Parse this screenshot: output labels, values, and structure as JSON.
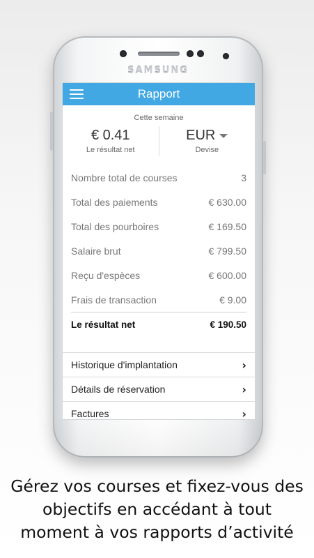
{
  "device": {
    "brand": "SAMSUNG"
  },
  "appbar": {
    "title": "Rapport",
    "menu_icon": "hamburger-menu-icon"
  },
  "summary": {
    "period": "Cette semaine",
    "net_value": "€ 0.41",
    "net_label": "Le résultat net",
    "currency_value": "EUR",
    "currency_label": "Devise"
  },
  "report_rows": [
    {
      "label": "Nombre total de courses",
      "value": "3"
    },
    {
      "label": "Total des paiements",
      "value": "€ 630.00"
    },
    {
      "label": "Total des pourboires",
      "value": "€ 169.50"
    },
    {
      "label": "Salaire brut",
      "value": "€ 799.50"
    },
    {
      "label": "Reçu d'espèces",
      "value": "€ 600.00"
    },
    {
      "label": "Frais de transaction",
      "value": "€ 9.00"
    }
  ],
  "total_row": {
    "label": "Le résultat net",
    "value": "€ 190.50"
  },
  "nav": [
    {
      "label": "Historique d'implantation"
    },
    {
      "label": "Détails de réservation"
    },
    {
      "label": "Factures"
    }
  ],
  "caption": {
    "line1": "Gérez vos courses et fixez-vous des",
    "line2": "objectifs en accédant à tout",
    "line3": "moment à vos rapports d’activité"
  },
  "colors": {
    "accent": "#41a8e4"
  }
}
